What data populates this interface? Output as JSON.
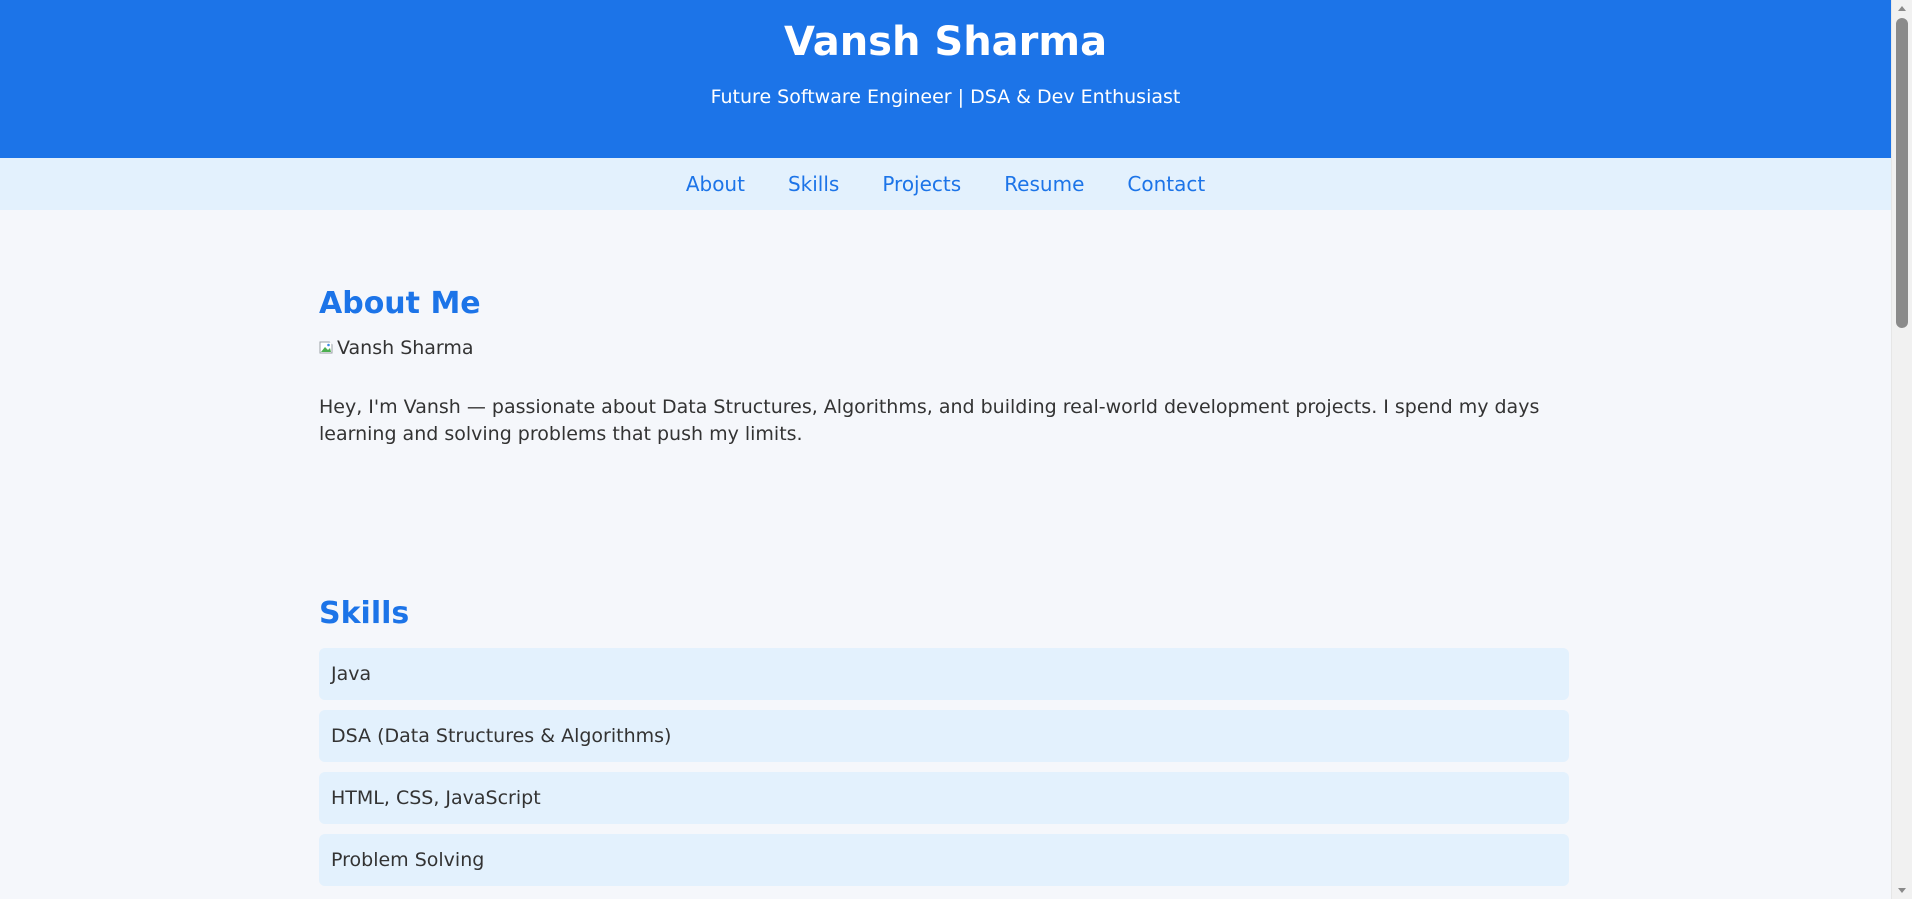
{
  "header": {
    "name": "Vansh Sharma",
    "tagline": "Future Software Engineer | DSA & Dev Enthusiast"
  },
  "nav": {
    "items": [
      {
        "label": "About"
      },
      {
        "label": "Skills"
      },
      {
        "label": "Projects"
      },
      {
        "label": "Resume"
      },
      {
        "label": "Contact"
      }
    ]
  },
  "about": {
    "title": "About Me",
    "photo_alt": "Vansh Sharma",
    "text": "Hey, I'm Vansh — passionate about Data Structures, Algorithms, and building real-world development projects. I spend my days learning and solving problems that push my limits."
  },
  "skills": {
    "title": "Skills",
    "items": [
      {
        "label": "Java"
      },
      {
        "label": "DSA (Data Structures & Algorithms)"
      },
      {
        "label": "HTML, CSS, JavaScript"
      },
      {
        "label": "Problem Solving"
      }
    ]
  },
  "colors": {
    "accent": "#1c74e8",
    "nav_bg": "#e3f1fd",
    "page_bg": "#f5f7fb",
    "skill_bg": "#e3f1fd"
  },
  "icons": {
    "broken_image": "broken-image-icon"
  }
}
